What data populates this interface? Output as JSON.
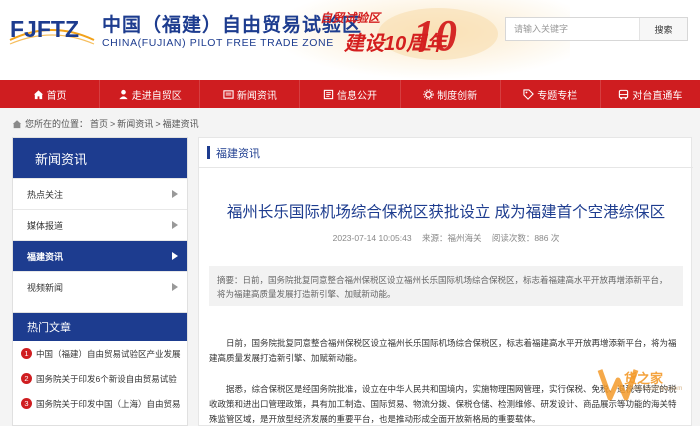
{
  "header": {
    "logo_text": "FJFTZ",
    "title": "中国（福建）自由贸易试验区",
    "subtitle": "CHINA(FUJIAN) PILOT FREE TRADE ZONE",
    "banner_small": "自贸试验区",
    "banner_big": "建设10周年",
    "search": {
      "placeholder": "请输入关键字",
      "button": "搜索"
    }
  },
  "nav": {
    "items": [
      {
        "label": "首页",
        "icon": "home-icon"
      },
      {
        "label": "走进自贸区",
        "icon": "person-icon"
      },
      {
        "label": "新闻资讯",
        "icon": "newspaper-icon"
      },
      {
        "label": "信息公开",
        "icon": "info-icon"
      },
      {
        "label": "制度创新",
        "icon": "gear-icon"
      },
      {
        "label": "专题专栏",
        "icon": "tag-icon"
      },
      {
        "label": "对台直通车",
        "icon": "bus-icon"
      }
    ]
  },
  "breadcrumb": {
    "prefix": "您所在的位置：",
    "items": [
      "首页",
      "新闻资讯",
      "福建资讯"
    ]
  },
  "sidebar": {
    "title": "新闻资讯",
    "items": [
      {
        "label": "热点关注",
        "active": false
      },
      {
        "label": "媒体报道",
        "active": false
      },
      {
        "label": "福建资讯",
        "active": true
      },
      {
        "label": "视频新闻",
        "active": false
      }
    ]
  },
  "hot": {
    "title": "热门文章",
    "items": [
      {
        "num": "1",
        "label": "中国（福建）自由贸易试验区产业发展"
      },
      {
        "num": "2",
        "label": "国务院关于印发6个新设自由贸易试验"
      },
      {
        "num": "3",
        "label": "国务院关于印发中国（上海）自由贸易"
      }
    ]
  },
  "main": {
    "section_title": "福建资讯",
    "article_title": "福州长乐国际机场综合保税区获批设立 成为福建首个空港综保区",
    "meta": {
      "date": "2023-07-14 10:05:43",
      "source": "来源：福州海关",
      "views": "阅读次数：886  次"
    },
    "summary": "摘要：日前，国务院批复同意整合福州保税区设立福州长乐国际机场综合保税区，标志着福建高水平开放再增添新平台，将为福建高质量发展打造新引擎、加赋新动能。",
    "paragraph1": "日前，国务院批复同意整合福州保税区设立福州长乐国际机场综合保税区，标志着福建高水平开放再增添新平台，将为福建高质量发展打造新引擎、加赋新动能。",
    "paragraph2": "据悉，综合保税区是经国务院批准，设立在中华人民共和国境内，实施物理围网管理，实行保税、免税、退税等特定的税收政策和进出口管理政策，具有加工制造、国际贸易、物流分拨、保税仓储、检测维修、研发设计、商品展示等功能的海关特殊监管区域，是开放型经济发展的重要平台，也是推动形成全面开放新格局的重要载体。"
  },
  "watermark": {
    "text": "货之家",
    "sub": "www.huozhijia.com"
  },
  "colors": {
    "brand_blue": "#1d3c8f",
    "nav_red": "#cf1d20"
  }
}
